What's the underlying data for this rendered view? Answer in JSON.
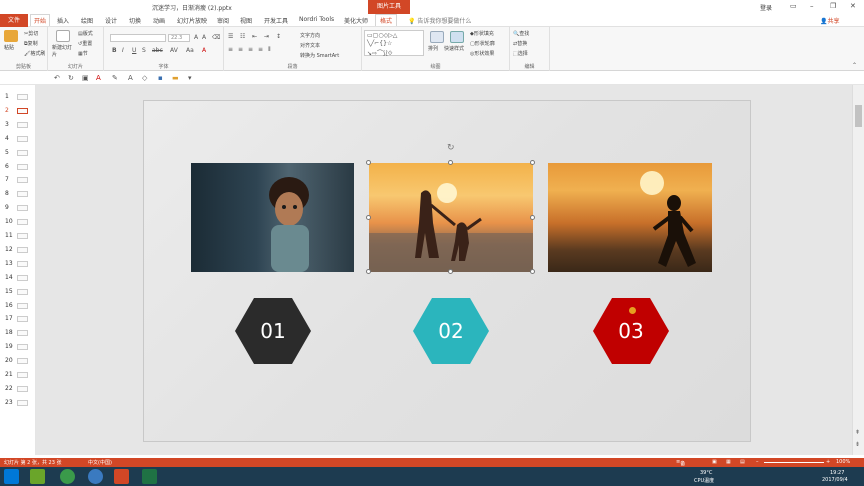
{
  "titlebar": {
    "document_title": "沉迷学习，日渐消瘦 (2).pptx",
    "context_tab_group": "图片工具",
    "login": "登录",
    "share": "共享"
  },
  "tabs": [
    "文件",
    "开始",
    "插入",
    "绘图",
    "设计",
    "切换",
    "动画",
    "幻灯片放映",
    "审阅",
    "视图",
    "开发工具",
    "Nordri Tools",
    "美化大师",
    "格式"
  ],
  "active_tab": "开始",
  "tell_me": "告诉我你想要做什么",
  "ribbon": {
    "clipboard": {
      "label": "剪贴板",
      "paste": "粘贴",
      "cut": "剪切",
      "copy": "复制",
      "format_painter": "格式刷"
    },
    "slides": {
      "label": "幻灯片",
      "new_slide": "新建幻灯片",
      "layout": "版式",
      "reset": "重置",
      "section": "节"
    },
    "font": {
      "label": "字体",
      "font_name": "",
      "font_size": "22.3"
    },
    "paragraph": {
      "label": "段落",
      "text_direction": "文字方向",
      "align_text": "对齐文本",
      "smartart": "转换为 SmartArt"
    },
    "drawing": {
      "label": "绘图",
      "arrange": "排列",
      "quick_styles": "快速样式",
      "shape_fill": "形状填充",
      "shape_outline": "形状轮廓",
      "shape_effects": "形状效果"
    },
    "editing": {
      "label": "编辑",
      "find": "查找",
      "replace": "替换",
      "select": "选择"
    }
  },
  "thumbnails": [
    "1",
    "2",
    "3",
    "4",
    "5",
    "6",
    "7",
    "8",
    "9",
    "10",
    "11",
    "12",
    "13",
    "14",
    "15",
    "16",
    "17",
    "18",
    "19",
    "20",
    "21",
    "22",
    "23"
  ],
  "selected_slide": "2",
  "slide": {
    "badges": [
      {
        "text": "01",
        "color": "#2b2b2b"
      },
      {
        "text": "02",
        "color": "#2bb5bd"
      },
      {
        "text": "03",
        "color": "#c00000"
      }
    ]
  },
  "statusbar": {
    "slide_info": "幻灯片 第 2 张，共 23 张",
    "language": "中文(中国)",
    "notes": "备注",
    "zoom": "100%"
  },
  "taskbar": {
    "temp": "39°C",
    "cpu": "CPU温度",
    "time": "19:27",
    "date": "2017/09/4"
  }
}
